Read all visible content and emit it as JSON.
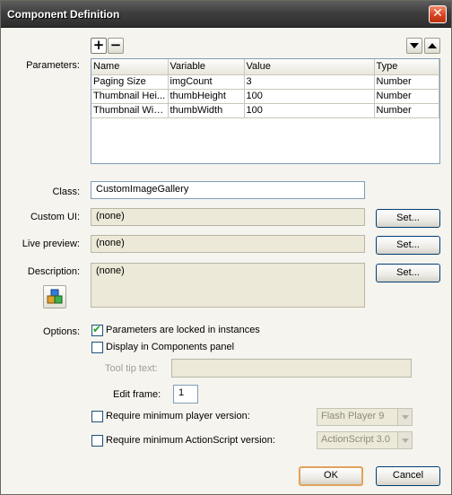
{
  "window": {
    "title": "Component Definition",
    "close_glyph": "✕"
  },
  "toolbar": {
    "add": "+",
    "remove": "−"
  },
  "labels": {
    "parameters": "Parameters:",
    "class": "Class:",
    "custom_ui": "Custom UI:",
    "live_preview": "Live preview:",
    "description": "Description:",
    "options": "Options:",
    "tooltip_text": "Tool tip text:",
    "edit_frame": "Edit frame:"
  },
  "params_table": {
    "columns": [
      "Name",
      "Variable",
      "Value",
      "Type"
    ],
    "rows": [
      [
        "Paging Size",
        "imgCount",
        "3",
        "Number"
      ],
      [
        "Thumbnail Hei...",
        "thumbHeight",
        "100",
        "Number"
      ],
      [
        "Thumbnail Width",
        "thumbWidth",
        "100",
        "Number"
      ]
    ]
  },
  "fields": {
    "class_value": "CustomImageGallery",
    "custom_ui_value": "(none)",
    "live_preview_value": "(none)",
    "description_value": "(none)",
    "tooltip_value": "",
    "edit_frame_value": "1"
  },
  "buttons": {
    "set": "Set...",
    "ok": "OK",
    "cancel": "Cancel"
  },
  "options": {
    "locked": {
      "label": "Parameters are locked in instances",
      "checked": true
    },
    "display_panel": {
      "label": "Display in Components panel",
      "checked": false
    },
    "min_player": {
      "label": "Require minimum player version:",
      "checked": false,
      "selected": "Flash Player 9"
    },
    "min_as": {
      "label": "Require minimum ActionScript version:",
      "checked": false,
      "selected": "ActionScript 3.0"
    }
  },
  "icons": {
    "add": "plus-icon",
    "remove": "minus-icon",
    "move_down": "arrow-down-icon",
    "move_up": "arrow-up-icon",
    "component": "component-cubes-icon",
    "check": "checkmark-icon"
  },
  "colors": {
    "accent_check": "#21a121",
    "titlebar": "#3f3f3f",
    "close": "#d8431f",
    "default_button_border": "#e0a35c"
  }
}
